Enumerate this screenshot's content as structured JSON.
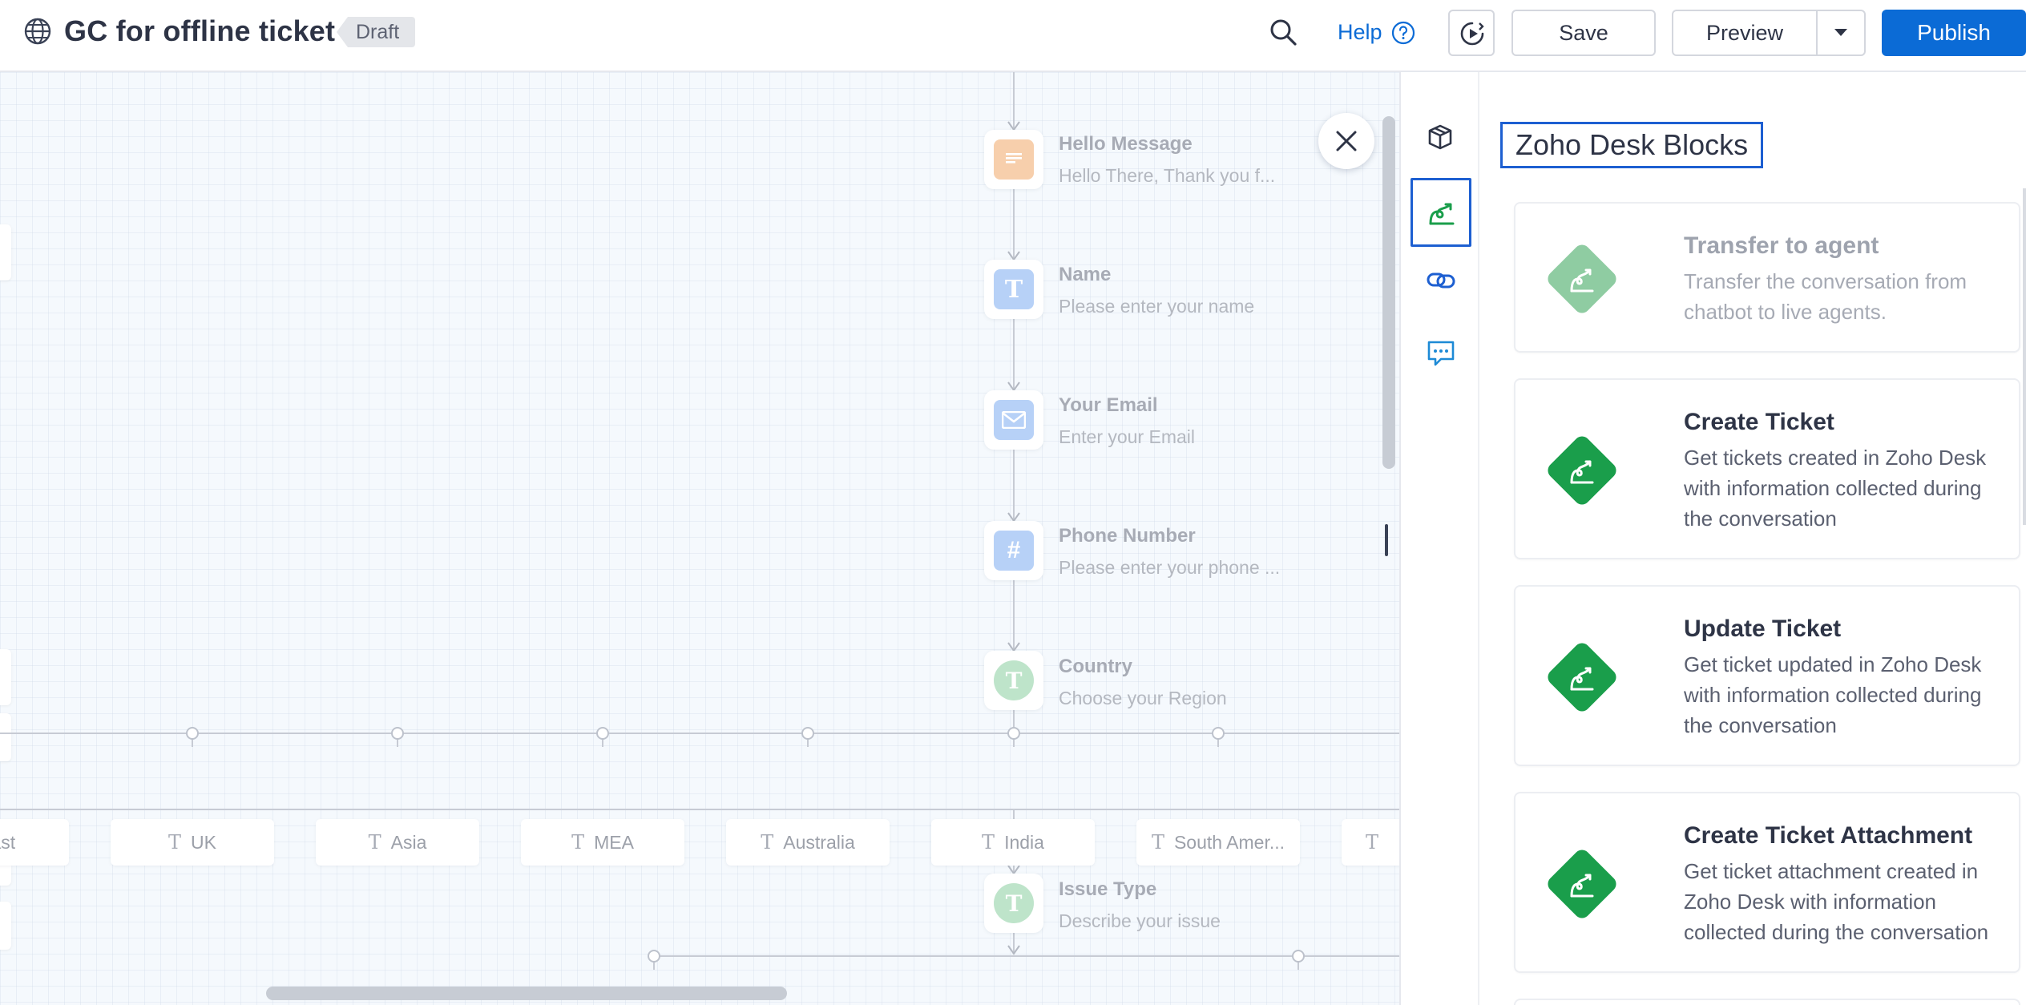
{
  "header": {
    "title": "GC for offline ticket",
    "status_badge": "Draft",
    "help_label": "Help",
    "save_label": "Save",
    "preview_label": "Preview",
    "publish_label": "Publish"
  },
  "colors": {
    "accent": "#0b6bd6",
    "zoho_green": "#1a9e4b",
    "zoho_green_disabled": "#8fcca2",
    "message_orange": "#f5bf91",
    "input_blue": "#9fc2f5",
    "choice_green": "#a9dbb9"
  },
  "canvas": {
    "nodes": [
      {
        "title": "Hello Message",
        "subtitle": "Hello There, Thank you f...",
        "icon": "message-icon"
      },
      {
        "title": "Name",
        "subtitle": "Please enter your name",
        "icon": "text-input-icon"
      },
      {
        "title": "Your Email",
        "subtitle": "Enter your Email",
        "icon": "email-input-icon"
      },
      {
        "title": "Phone Number",
        "subtitle": "Please enter your phone ...",
        "icon": "number-input-icon"
      },
      {
        "title": "Country",
        "subtitle": "Choose your Region",
        "icon": "single-choice-icon"
      },
      {
        "title": "Issue Type",
        "subtitle": "Describe your issue",
        "icon": "single-choice-icon"
      }
    ],
    "options": [
      "le East",
      "UK",
      "Asia",
      "MEA",
      "Australia",
      "India",
      "South Amer...",
      ""
    ]
  },
  "sidebar": {
    "items": [
      {
        "name": "blocks-icon"
      },
      {
        "name": "zoho-desk-icon"
      },
      {
        "name": "link-icon"
      },
      {
        "name": "chat-icon"
      }
    ]
  },
  "panel": {
    "title": "Zoho Desk Blocks",
    "cards": [
      {
        "title": "Transfer to agent",
        "description": "Transfer the conversation from chatbot to live agents."
      },
      {
        "title": "Create Ticket",
        "description": "Get tickets created in Zoho Desk with information collected during the conversation"
      },
      {
        "title": "Update Ticket",
        "description": "Get ticket updated in Zoho Desk with information collected during the conversation"
      },
      {
        "title": "Create Ticket Attachment",
        "description": "Get ticket attachment created in Zoho Desk with information collected during the conversation"
      }
    ]
  }
}
